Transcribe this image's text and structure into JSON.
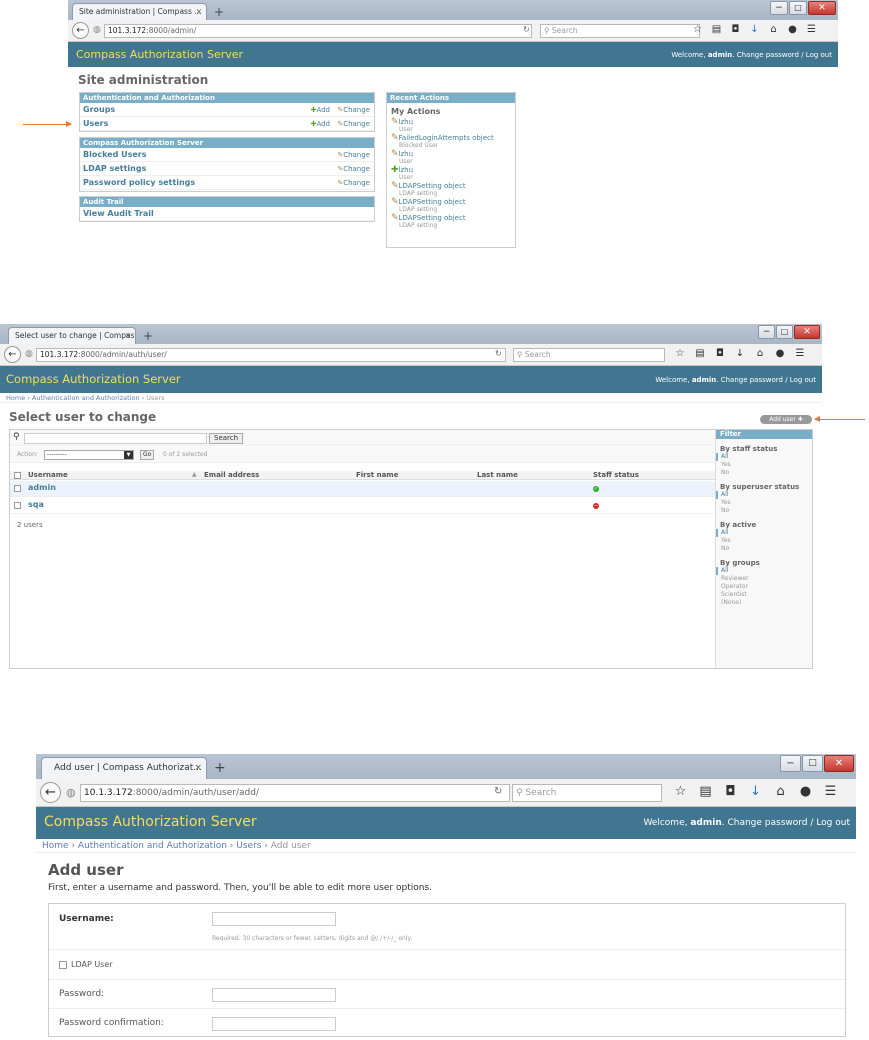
{
  "colors": {
    "header": "#417690",
    "brand": "#f5dd5d",
    "module_caption": "#79aec8",
    "link": "#447e9b",
    "arrow": "#e4782f"
  },
  "brand": "Compass Authorization Server",
  "user_tools": {
    "welcome": "Welcome,",
    "user": "admin",
    "change_password": "Change password",
    "sep": "/",
    "logout": "Log out"
  },
  "icons": {
    "back": "arrow-left-icon",
    "star": "star-icon",
    "clipboard": "clipboard-icon",
    "pocket": "pocket-icon",
    "download": "download-icon",
    "home": "home-icon",
    "chat": "chat-icon",
    "menu": "hamburger-icon",
    "close": "close-icon",
    "add": "plus-icon",
    "change": "pencil-icon",
    "search": "magnifier-icon"
  },
  "screen1": {
    "tab_title": "Site administration | Compass ...",
    "url_host": "101.3.172",
    "url_rest": ":8000/admin/",
    "search_placeholder": "Search",
    "page_title": "Site administration",
    "modules": [
      {
        "caption": "Authentication and Authorization",
        "rows": [
          {
            "name": "Groups",
            "add": "Add",
            "change": "Change"
          },
          {
            "name": "Users",
            "add": "Add",
            "change": "Change"
          }
        ]
      },
      {
        "caption": "Compass Authorization Server",
        "rows": [
          {
            "name": "Blocked Users",
            "change": "Change"
          },
          {
            "name": "LDAP settings",
            "change": "Change"
          },
          {
            "name": "Password policy settings",
            "change": "Change"
          }
        ]
      },
      {
        "caption": "Audit Trail",
        "rows": [
          {
            "name": "View Audit Trail"
          }
        ]
      }
    ],
    "recent": {
      "caption": "Recent Actions",
      "my_actions": "My Actions",
      "items": [
        {
          "icon": "pencil",
          "name": "lzhu",
          "type": "User"
        },
        {
          "icon": "pencil",
          "name": "FailedLoginAttempts object",
          "type": "Blocked User"
        },
        {
          "icon": "pencil",
          "name": "lzhu",
          "type": "User"
        },
        {
          "icon": "plus",
          "name": "lzhu",
          "type": "User"
        },
        {
          "icon": "pencil",
          "name": "LDAPSetting object",
          "type": "LDAP setting"
        },
        {
          "icon": "pencil",
          "name": "LDAPSetting object",
          "type": "LDAP setting"
        },
        {
          "icon": "pencil",
          "name": "LDAPSetting object",
          "type": "LDAP setting"
        }
      ]
    }
  },
  "screen2": {
    "tab_title": "Select user to change | Compas...",
    "url_host": "101.3.172",
    "url_rest": ":8000/admin/auth/user/",
    "search_placeholder": "Search",
    "breadcrumbs": [
      "Home",
      "Authentication and Authorization",
      "Users"
    ],
    "page_title": "Select user to change",
    "add_user_button": "Add user",
    "search_button": "Search",
    "action_label": "Action:",
    "action_value": "---------",
    "go_button": "Go",
    "selected_text": "0 of 2 selected",
    "columns": [
      "Username",
      "Email address",
      "First name",
      "Last name",
      "Staff status"
    ],
    "rows": [
      {
        "username": "admin",
        "email": "",
        "first": "",
        "last": "",
        "staff": true
      },
      {
        "username": "sqa",
        "email": "",
        "first": "",
        "last": "",
        "staff": false
      }
    ],
    "count_text": "2 users",
    "filter": {
      "caption": "Filter",
      "groups": [
        {
          "title": "By staff status",
          "options": [
            "All",
            "Yes",
            "No"
          ]
        },
        {
          "title": "By superuser status",
          "options": [
            "All",
            "Yes",
            "No"
          ]
        },
        {
          "title": "By active",
          "options": [
            "All",
            "Yes",
            "No"
          ]
        },
        {
          "title": "By groups",
          "options": [
            "All",
            "Reviewer",
            "Operator",
            "Scientist",
            "(None)"
          ]
        }
      ]
    }
  },
  "screen3": {
    "tab_title": "Add user | Compass Authorizat...",
    "url_host": "10.1.3.172",
    "url_rest": ":8000/admin/auth/user/add/",
    "search_placeholder": "Search",
    "breadcrumbs": [
      "Home",
      "Authentication and Authorization",
      "Users",
      "Add user"
    ],
    "page_title": "Add user",
    "subtitle": "First, enter a username and password. Then, you'll be able to edit more user options.",
    "fields": {
      "username_label": "Username:",
      "username_help": "Required. 30 characters or fewer. Letters, digits and @/./+/-/_ only.",
      "ldap_label": "LDAP User",
      "password_label": "Password:",
      "password_confirm_label": "Password confirmation:"
    }
  }
}
